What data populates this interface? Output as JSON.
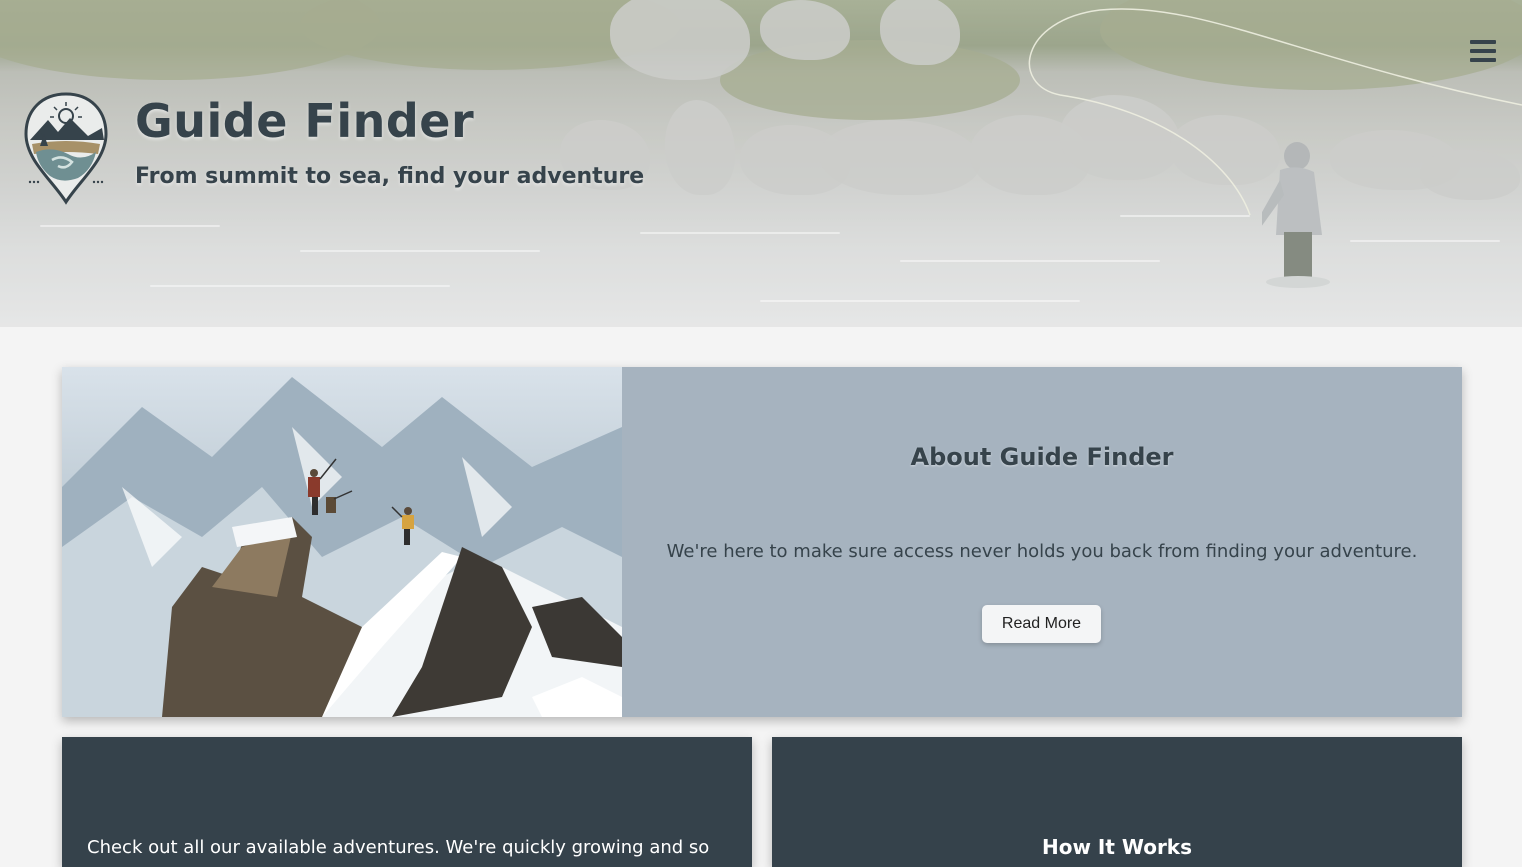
{
  "header": {
    "title": "Guide Finder",
    "tagline": "From summit to sea, find your adventure",
    "logo_icon": "map-pin-mountain-logo-icon",
    "menu_icon": "hamburger-menu-icon",
    "hero_image": "fly-fisherman-in-river-photo"
  },
  "about": {
    "heading": "About Guide Finder",
    "text": "We're here to make sure access never holds you back from finding your adventure.",
    "button_label": "Read More",
    "image": "climbers-on-snowy-peak-photo"
  },
  "adventures": {
    "text": "Check out all our available adventures. We're quickly growing and so"
  },
  "how_it_works": {
    "heading": "How It Works"
  },
  "colors": {
    "primary": "#36434b",
    "card_dark": "#35424b",
    "about_panel": "#a6b3bf",
    "page_bg": "#f4f4f4",
    "button_bg": "#f4f5f6"
  }
}
